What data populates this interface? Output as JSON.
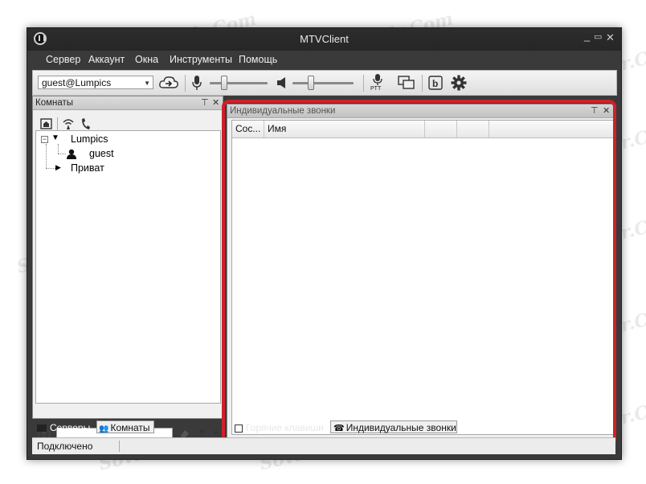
{
  "window": {
    "title": "MTVClient",
    "controls": {
      "minimize": "_",
      "maximize": "▭",
      "close": "✕"
    }
  },
  "menu": {
    "items": [
      "Сервер",
      "Аккаунт",
      "Окна",
      "Инструменты",
      "Помощь"
    ]
  },
  "toolbar": {
    "user_select_value": "guest@Lumpics",
    "ptt_label": "PTT",
    "icons": [
      "cloud-connect-icon",
      "microphone-icon",
      "speaker-icon",
      "ptt-microphone-icon",
      "windows-icon",
      "b-icon",
      "gear-icon"
    ],
    "mic_level_pct": 25,
    "volume_level_pct": 30
  },
  "rooms_panel": {
    "title": "Комнаты",
    "pin": "⊤",
    "close": "✕",
    "tree": [
      {
        "label": "Lumpics",
        "level": 0,
        "expanded": true
      },
      {
        "label": "guest",
        "level": 1
      },
      {
        "label": "Приват",
        "level": 0,
        "expanded": false
      }
    ],
    "search_placeholder": ""
  },
  "calls_panel": {
    "title": "Индивидуальные звонки",
    "pin": "⊤",
    "close": "✕",
    "columns": [
      "Сос...",
      "Имя",
      "",
      "",
      ""
    ],
    "rows": []
  },
  "bottom_tabs_left": [
    "Серверы",
    "Комнаты"
  ],
  "bottom_tabs_right": [
    "Горячие клавиши",
    "Индивидуальные звонки"
  ],
  "status": {
    "text": "Подключено"
  },
  "watermark": "Sovingsperpair.Com",
  "colors": {
    "highlight": "#d0202a",
    "titlebar": "#2b2b2b",
    "menubar": "#3a3a3a"
  }
}
